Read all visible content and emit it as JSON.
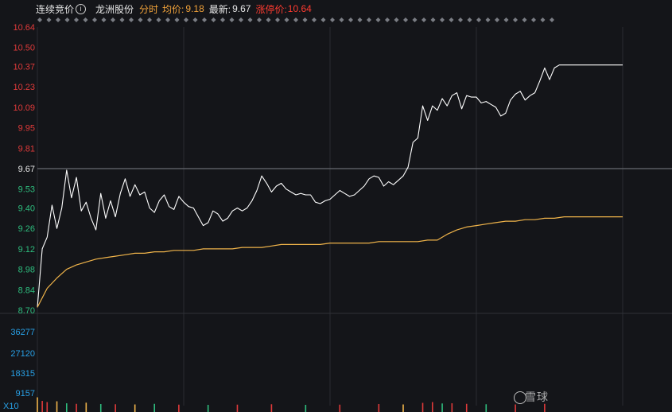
{
  "header": {
    "auction_label": "连续竞价",
    "info_icon_glyph": "i",
    "stock_name": "龙洲股份",
    "mode": "分时",
    "avg_label": "均价:",
    "avg_value": "9.18",
    "last_label": "最新:",
    "last_value": "9.67",
    "limit_label": "涨停价:",
    "limit_value": "10.64"
  },
  "colors": {
    "background": "#141519",
    "price_line": "#ffffff",
    "avg_line": "#f0b44a",
    "up": "#e03a3a",
    "down": "#2ebd7e",
    "volume_axis": "#28a0e6",
    "grid": "#2a2c31"
  },
  "chart_data": {
    "type": "line",
    "title": "",
    "y_ticks": [
      {
        "label": "10.64",
        "value": 10.64,
        "tone": "up"
      },
      {
        "label": "10.50",
        "value": 10.5,
        "tone": "up"
      },
      {
        "label": "10.37",
        "value": 10.37,
        "tone": "up"
      },
      {
        "label": "10.23",
        "value": 10.23,
        "tone": "up"
      },
      {
        "label": "10.09",
        "value": 10.09,
        "tone": "up"
      },
      {
        "label": "9.95",
        "value": 9.95,
        "tone": "up"
      },
      {
        "label": "9.81",
        "value": 9.81,
        "tone": "up"
      },
      {
        "label": "9.67",
        "value": 9.67,
        "tone": "neutral"
      },
      {
        "label": "9.53",
        "value": 9.53,
        "tone": "down"
      },
      {
        "label": "9.40",
        "value": 9.4,
        "tone": "down"
      },
      {
        "label": "9.26",
        "value": 9.26,
        "tone": "down"
      },
      {
        "label": "9.12",
        "value": 9.12,
        "tone": "down"
      },
      {
        "label": "8.98",
        "value": 8.98,
        "tone": "down"
      },
      {
        "label": "8.84",
        "value": 8.84,
        "tone": "down"
      },
      {
        "label": "8.70",
        "value": 8.7,
        "tone": "down"
      }
    ],
    "ylim": [
      8.7,
      10.64
    ],
    "prev_close": 9.67,
    "x_range": [
      0,
      240
    ],
    "series": [
      {
        "key": "price",
        "x": [
          0,
          2,
          4,
          6,
          8,
          10,
          12,
          14,
          16,
          18,
          20,
          22,
          24,
          26,
          28,
          30,
          32,
          34,
          36,
          38,
          40,
          42,
          44,
          46,
          48,
          50,
          52,
          54,
          56,
          58,
          60,
          62,
          64,
          66,
          68,
          70,
          72,
          74,
          76,
          78,
          80,
          82,
          84,
          86,
          88,
          90,
          92,
          94,
          96,
          98,
          100,
          102,
          104,
          106,
          108,
          110,
          112,
          114,
          116,
          118,
          120,
          122,
          124,
          126,
          128,
          130,
          132,
          134,
          136,
          138,
          140,
          142,
          144,
          146,
          148,
          150,
          152,
          154,
          156,
          158,
          160,
          162,
          164,
          166,
          168,
          170,
          172,
          174,
          176,
          178,
          180,
          182,
          184,
          186,
          188,
          190,
          192,
          194,
          196,
          198,
          200,
          202,
          204,
          206,
          208,
          210,
          212,
          214,
          216,
          218,
          220,
          222,
          224,
          226,
          228,
          230,
          232,
          234,
          236,
          238,
          240
        ],
        "values": [
          8.72,
          9.12,
          9.2,
          9.42,
          9.26,
          9.4,
          9.66,
          9.47,
          9.61,
          9.38,
          9.44,
          9.33,
          9.25,
          9.5,
          9.33,
          9.45,
          9.34,
          9.5,
          9.6,
          9.48,
          9.56,
          9.49,
          9.51,
          9.4,
          9.37,
          9.45,
          9.49,
          9.41,
          9.39,
          9.48,
          9.44,
          9.41,
          9.4,
          9.34,
          9.28,
          9.3,
          9.38,
          9.36,
          9.31,
          9.33,
          9.38,
          9.4,
          9.38,
          9.4,
          9.45,
          9.52,
          9.62,
          9.57,
          9.51,
          9.55,
          9.57,
          9.53,
          9.51,
          9.49,
          9.5,
          9.49,
          9.49,
          9.44,
          9.43,
          9.45,
          9.46,
          9.49,
          9.52,
          9.5,
          9.48,
          9.49,
          9.52,
          9.55,
          9.6,
          9.62,
          9.61,
          9.55,
          9.58,
          9.56,
          9.59,
          9.62,
          9.68,
          9.85,
          9.88,
          10.1,
          10.0,
          10.1,
          10.07,
          10.15,
          10.1,
          10.17,
          10.19,
          10.08,
          10.17,
          10.16,
          10.16,
          10.12,
          10.13,
          10.11,
          10.09,
          10.03,
          10.05,
          10.14,
          10.18,
          10.2,
          10.14,
          10.17,
          10.19,
          10.27,
          10.36,
          10.28,
          10.36,
          10.38,
          10.38,
          10.38,
          10.38,
          10.38,
          10.38,
          10.38,
          10.38,
          10.38,
          10.38,
          10.38,
          10.38,
          10.38,
          10.38
        ]
      },
      {
        "key": "avg",
        "x": [
          0,
          4,
          8,
          12,
          16,
          20,
          24,
          28,
          32,
          36,
          40,
          44,
          48,
          52,
          56,
          60,
          64,
          68,
          72,
          76,
          80,
          84,
          88,
          92,
          96,
          100,
          104,
          108,
          112,
          116,
          120,
          124,
          128,
          132,
          136,
          140,
          144,
          148,
          152,
          156,
          160,
          164,
          168,
          172,
          176,
          180,
          184,
          188,
          192,
          196,
          200,
          204,
          208,
          212,
          216,
          220,
          224,
          228,
          232,
          236,
          240
        ],
        "values": [
          8.72,
          8.85,
          8.92,
          8.98,
          9.01,
          9.03,
          9.05,
          9.06,
          9.07,
          9.08,
          9.09,
          9.09,
          9.1,
          9.1,
          9.11,
          9.11,
          9.11,
          9.12,
          9.12,
          9.12,
          9.12,
          9.13,
          9.13,
          9.13,
          9.14,
          9.15,
          9.15,
          9.15,
          9.15,
          9.15,
          9.16,
          9.16,
          9.16,
          9.16,
          9.16,
          9.17,
          9.17,
          9.17,
          9.17,
          9.17,
          9.18,
          9.18,
          9.22,
          9.25,
          9.27,
          9.28,
          9.29,
          9.3,
          9.31,
          9.31,
          9.32,
          9.32,
          9.33,
          9.33,
          9.34,
          9.34,
          9.34,
          9.34,
          9.34,
          9.34,
          9.34
        ]
      }
    ],
    "volume": {
      "axis_ticks": [
        "36277",
        "27120",
        "18315",
        "9157"
      ],
      "unit_label": "X10",
      "ylim": [
        0,
        45000
      ],
      "samples": [
        {
          "x": 0,
          "v": 4200,
          "tone": "avg"
        },
        {
          "x": 2,
          "v": 2400,
          "tone": "up"
        },
        {
          "x": 4,
          "v": 1800,
          "tone": "up"
        },
        {
          "x": 8,
          "v": 2200,
          "tone": "avg"
        },
        {
          "x": 12,
          "v": 1200,
          "tone": "down"
        },
        {
          "x": 16,
          "v": 900,
          "tone": "up"
        },
        {
          "x": 20,
          "v": 1500,
          "tone": "avg"
        },
        {
          "x": 26,
          "v": 800,
          "tone": "down"
        },
        {
          "x": 32,
          "v": 700,
          "tone": "up"
        },
        {
          "x": 40,
          "v": 600,
          "tone": "avg"
        },
        {
          "x": 48,
          "v": 900,
          "tone": "down"
        },
        {
          "x": 58,
          "v": 500,
          "tone": "up"
        },
        {
          "x": 70,
          "v": 400,
          "tone": "down"
        },
        {
          "x": 82,
          "v": 500,
          "tone": "up"
        },
        {
          "x": 96,
          "v": 700,
          "tone": "up"
        },
        {
          "x": 110,
          "v": 400,
          "tone": "down"
        },
        {
          "x": 124,
          "v": 500,
          "tone": "up"
        },
        {
          "x": 140,
          "v": 800,
          "tone": "up"
        },
        {
          "x": 150,
          "v": 600,
          "tone": "avg"
        },
        {
          "x": 158,
          "v": 1400,
          "tone": "up"
        },
        {
          "x": 162,
          "v": 1800,
          "tone": "up"
        },
        {
          "x": 166,
          "v": 1100,
          "tone": "down"
        },
        {
          "x": 170,
          "v": 1200,
          "tone": "up"
        },
        {
          "x": 176,
          "v": 900,
          "tone": "up"
        },
        {
          "x": 184,
          "v": 700,
          "tone": "down"
        },
        {
          "x": 196,
          "v": 600,
          "tone": "up"
        },
        {
          "x": 208,
          "v": 900,
          "tone": "up"
        }
      ]
    },
    "grid": true
  },
  "watermark_text": "雪球"
}
